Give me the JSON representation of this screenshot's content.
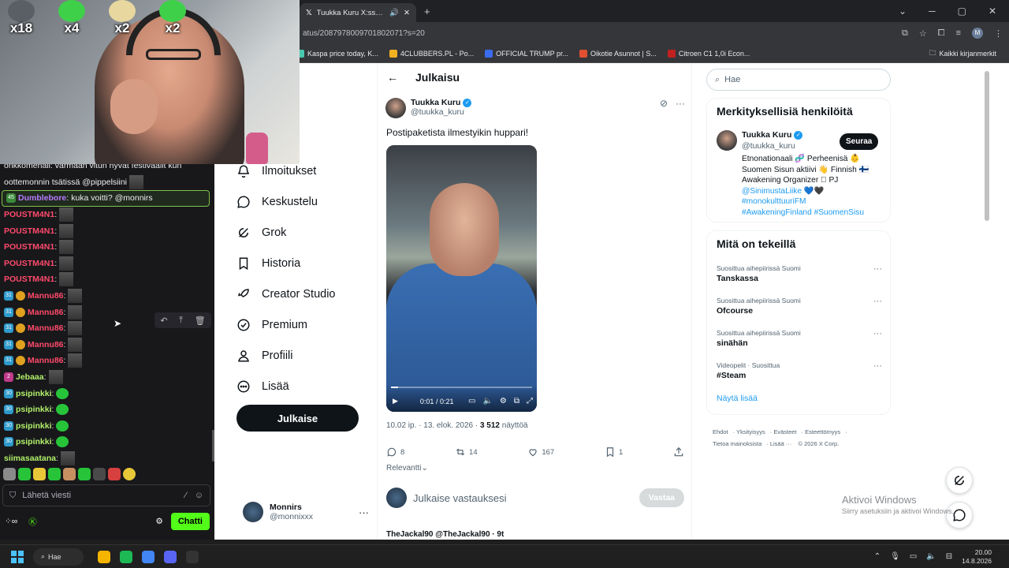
{
  "webcam": {
    "badges": [
      {
        "count": "x18",
        "color": "#5a5f66"
      },
      {
        "count": "x4",
        "color": "#3fd04a"
      },
      {
        "count": "x2",
        "color": "#e8d8a0"
      },
      {
        "count": "x2",
        "color": "#3fd04a"
      }
    ]
  },
  "chat": {
    "partial_line": "oottemonnin tsätissä @pippelsiini",
    "partial_line_top": "onkkomenali: varmaan vitun hyvät festivaalit kun",
    "highlight": {
      "user": "Dumblebore",
      "message": "kuka voitti? @monnirs"
    },
    "lines": [
      {
        "user": "POUSTM4N1",
        "color": "#ff4a6a",
        "badge": ""
      },
      {
        "user": "POUSTM4N1",
        "color": "#ff4a6a",
        "badge": ""
      },
      {
        "user": "POUSTM4N1",
        "color": "#ff4a6a",
        "badge": ""
      },
      {
        "user": "POUSTM4N1",
        "color": "#ff4a6a",
        "badge": ""
      },
      {
        "user": "POUSTM4N1",
        "color": "#ff4a6a",
        "badge": ""
      },
      {
        "user": "Mannu86",
        "color": "#ff4a6a",
        "badge": "31"
      },
      {
        "user": "Mannu86",
        "color": "#ff4a6a",
        "badge": "31"
      },
      {
        "user": "Mannu86",
        "color": "#ff4a6a",
        "badge": "31"
      },
      {
        "user": "Mannu86",
        "color": "#ff4a6a",
        "badge": "31"
      },
      {
        "user": "Mannu86",
        "color": "#ff4a6a",
        "badge": "31"
      },
      {
        "user": "Jebaaa",
        "color": "#b1f06a",
        "badge": "2"
      },
      {
        "user": "psipinkki",
        "color": "#b1f06a",
        "badge": "30"
      },
      {
        "user": "psipinkki",
        "color": "#b1f06a",
        "badge": "30"
      },
      {
        "user": "psipinkki",
        "color": "#b1f06a",
        "badge": "30"
      },
      {
        "user": "psipinkki",
        "color": "#b1f06a",
        "badge": "30"
      },
      {
        "user": "siimasaatana",
        "color": "#b1f06a",
        "badge": ""
      }
    ],
    "input_placeholder": "Lähetä viesti",
    "send_label": "Chatti",
    "highlight_badge": "45"
  },
  "browser": {
    "tab_title": "Tuukka Kuru X:ssä: \"Postipa",
    "url": "atus/2087978009701802071?s=20",
    "bookmarks": [
      {
        "label": "Kaspa price today, K...",
        "color": "#49c8b0"
      },
      {
        "label": "4CLUBBERS.PL - Po...",
        "color": "#f0b020"
      },
      {
        "label": "OFFICIAL TRUMP pr...",
        "color": "#3a6cf0"
      },
      {
        "label": "Oikotie Asunnot | S...",
        "color": "#e05030"
      },
      {
        "label": "Citroen C1 1,0i Econ...",
        "color": "#c02020"
      }
    ],
    "bookmarks_all": "Kaikki kirjanmerkit",
    "avatar_letter": "M"
  },
  "nav": {
    "items": [
      {
        "label": "Ilmoitukset",
        "icon": "bell-icon"
      },
      {
        "label": "Keskustelu",
        "icon": "chat-bubble-icon"
      },
      {
        "label": "Grok",
        "icon": "grok-icon"
      },
      {
        "label": "Historia",
        "icon": "bookmark-icon"
      },
      {
        "label": "Creator Studio",
        "icon": "rocket-icon"
      },
      {
        "label": "Premium",
        "icon": "verified-badge-icon"
      },
      {
        "label": "Profiili",
        "icon": "person-icon"
      },
      {
        "label": "Lisää",
        "icon": "more-circle-icon"
      }
    ],
    "post_button": "Julkaise",
    "account": {
      "name": "Monnirs",
      "handle": "@monnixxx"
    },
    "partial_glyph": "u"
  },
  "post": {
    "header": "Julkaisu",
    "author_name": "Tuukka Kuru",
    "author_handle": "@tuukka_kuru",
    "text": "Postipaketista ilmestyikin huppari!",
    "video_time": "0:01 / 0:21",
    "video_progress": 0.05,
    "meta_time": "10.02 ip. · 13. elok. 2026 · ",
    "meta_views_num": "3 512",
    "meta_views_label": " näyttöä",
    "replies": "8",
    "reposts": "14",
    "likes": "167",
    "bookmarks": "1",
    "sort_label": "Relevantti",
    "reply_placeholder": "Julkaise vastauksesi",
    "reply_button": "Vastaa",
    "next_post": "TheJackal90 @TheJackal90 · 9t"
  },
  "sidebar": {
    "search_placeholder": "Hae",
    "relevant_title": "Merkityksellisiä henkilöitä",
    "rel_name": "Tuukka Kuru",
    "rel_handle": "@tuukka_kuru",
    "follow": "Seuraa",
    "bio_line1": "Etnonationaali 🧬 Perheenisä 👶",
    "bio_line2": "Suomen Sisun aktiivi 👋 Finnish 🇫🇮",
    "bio_line3": "Awakening Organizer 🏻 PJ",
    "bio_link1": "@SinimustaLiike",
    "bio_link1_suffix": " 💙🖤",
    "bio_link2": "#monokulttuuriFM",
    "bio_link3": "#AwakeningFinland #SuomenSisu",
    "trends_title": "Mitä on tekeillä",
    "trends": [
      {
        "context": "Suosittua aihepiirissä Suomi",
        "title": "Tanskassa"
      },
      {
        "context": "Suosittua aihepiirissä Suomi",
        "title": "Ofcourse"
      },
      {
        "context": "Suosittua aihepiirissä Suomi",
        "title": "sinähän"
      },
      {
        "context": "Videopelit · Suosittua",
        "title": "#Steam"
      }
    ],
    "show_more": "Näytä lisää",
    "footer_line1": [
      "Ehdot",
      "Yksityisyys",
      "Evästeet",
      "Esteettömyys"
    ],
    "footer_line2": [
      "Tietoa mainoksista",
      "Lisää ···",
      "© 2026 X Corp."
    ]
  },
  "windows_activation": {
    "title": "Aktivoi Windows",
    "subtitle": "Siirry asetuksiin ja aktivoi Windows."
  },
  "taskbar": {
    "search_label": "Hae",
    "time": "20.00",
    "date": "14.8.2026",
    "apps": [
      "#f4b400",
      "#1db954",
      "#4285f4",
      "#5865f2",
      "#333333"
    ]
  }
}
